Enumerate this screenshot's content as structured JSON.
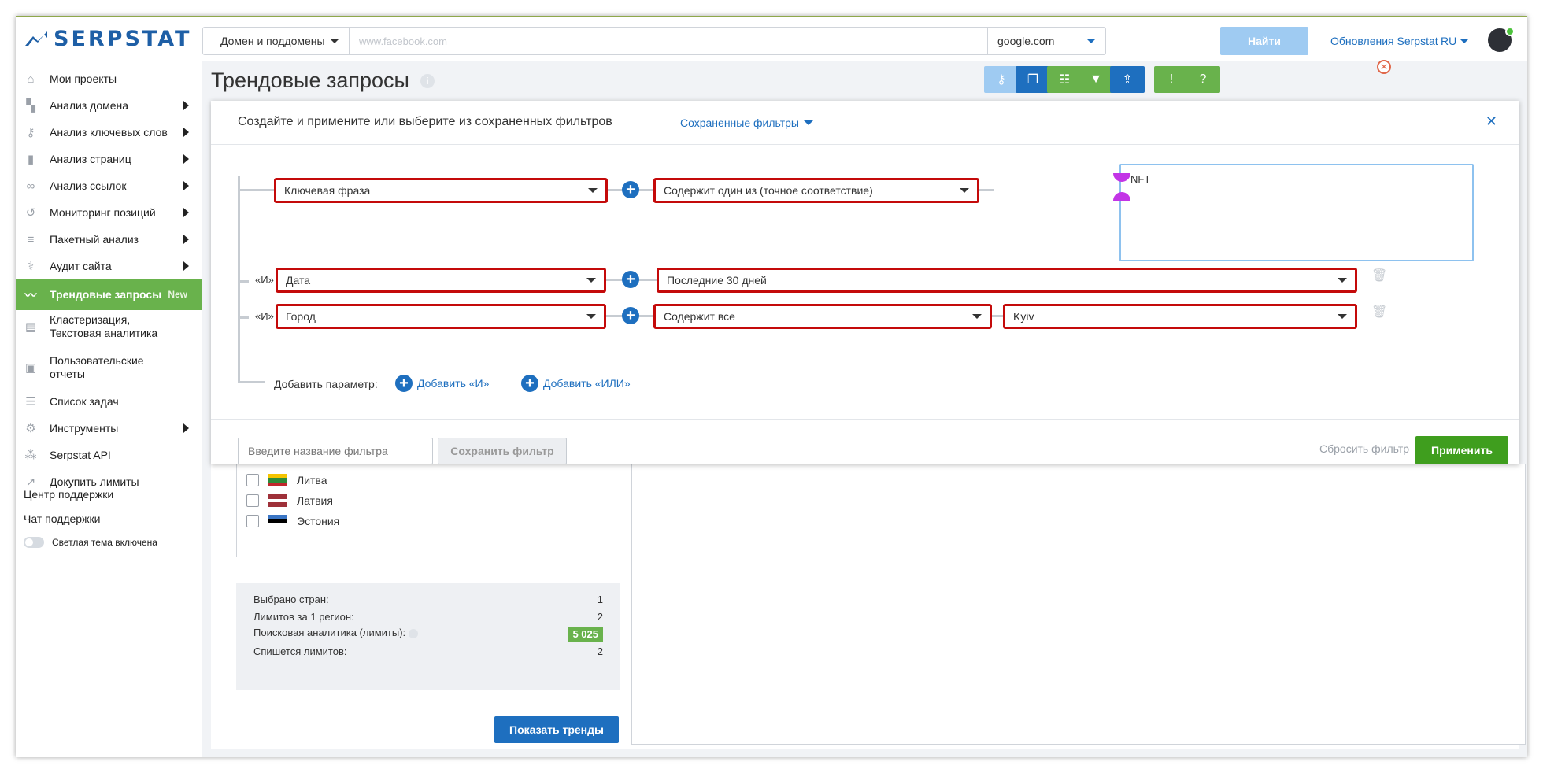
{
  "header": {
    "logo_text": "SERPSTAT",
    "scope_select": "Домен и поддомены",
    "search_placeholder": "www.facebook.com",
    "engine_select": "google.com",
    "find_button": "Найти",
    "updates_link": "Обновления Serpstat",
    "language": "RU"
  },
  "sidebar": {
    "items": [
      {
        "label": "Мои проекты",
        "icon": "home-icon"
      },
      {
        "label": "Анализ домена",
        "icon": "domain-icon"
      },
      {
        "label": "Анализ ключевых слов",
        "icon": "key-icon"
      },
      {
        "label": "Анализ страниц",
        "icon": "bar-chart-icon"
      },
      {
        "label": "Анализ ссылок",
        "icon": "link-icon"
      },
      {
        "label": "Мониторинг позиций",
        "icon": "history-icon"
      },
      {
        "label": "Пакетный анализ",
        "icon": "database-icon"
      },
      {
        "label": "Аудит сайта",
        "icon": "audit-icon"
      },
      {
        "label": "Трендовые запросы",
        "icon": "trend-icon",
        "badge": "New"
      },
      {
        "label": "Кластеризация,",
        "label2": "Текстовая аналитика",
        "icon": "cluster-icon"
      },
      {
        "label": "Пользовательские",
        "label2": "отчеты",
        "icon": "report-icon"
      },
      {
        "label": "Список задач",
        "icon": "list-icon"
      },
      {
        "label": "Инструменты",
        "icon": "gear-icon"
      },
      {
        "label": "Serpstat API",
        "icon": "api-icon"
      },
      {
        "label": "Докупить лимиты",
        "icon": "limits-icon"
      }
    ],
    "support_center": "Центр поддержки",
    "support_chat": "Чат поддержки",
    "theme_toggle": "Светлая тема включена"
  },
  "page": {
    "title": "Трендовые запросы"
  },
  "filter_panel": {
    "title": "Создайте и примените или выберите из сохраненных фильтров",
    "saved_filters": "Сохраненные фильтры",
    "rows": [
      {
        "field": "Ключевая фраза",
        "condition": "Содержит один из (точное соответствие)",
        "value": "NFT"
      },
      {
        "connector": "«И»",
        "field": "Дата",
        "condition": "Последние 30 дней"
      },
      {
        "connector": "«И»",
        "field": "Город",
        "condition": "Содержит все",
        "value": "Kyiv"
      }
    ],
    "add_param_label": "Добавить параметр:",
    "add_and": "Добавить «И»",
    "add_or": "Добавить «ИЛИ»",
    "filter_name_placeholder": "Введите название фильтра",
    "save_button": "Сохранить фильтр",
    "reset_link": "Сбросить фильтр",
    "apply_button": "Применить"
  },
  "countries": [
    {
      "name": "Литва",
      "colors": [
        "#f5c400",
        "#2e8b3a",
        "#c1272d"
      ]
    },
    {
      "name": "Латвия",
      "colors": [
        "#9e3039",
        "#ffffff",
        "#9e3039"
      ]
    },
    {
      "name": "Эстония",
      "colors": [
        "#3a75c4",
        "#000000",
        "#ffffff"
      ]
    }
  ],
  "stats": {
    "countries_selected_label": "Выбрано стран:",
    "countries_selected_value": "1",
    "limits_per_region_label": "Лимитов за 1 регион:",
    "limits_per_region_value": "2",
    "search_analytics_label": "Поисковая аналитика (лимиты):",
    "search_analytics_value": "5 025",
    "will_charge_label": "Спишется лимитов:",
    "will_charge_value": "2"
  },
  "show_trends_button": "Показать тренды",
  "colors": {
    "brand_blue": "#1e6fbf",
    "green": "#69b24c",
    "filter_border": "#c40a0a"
  }
}
